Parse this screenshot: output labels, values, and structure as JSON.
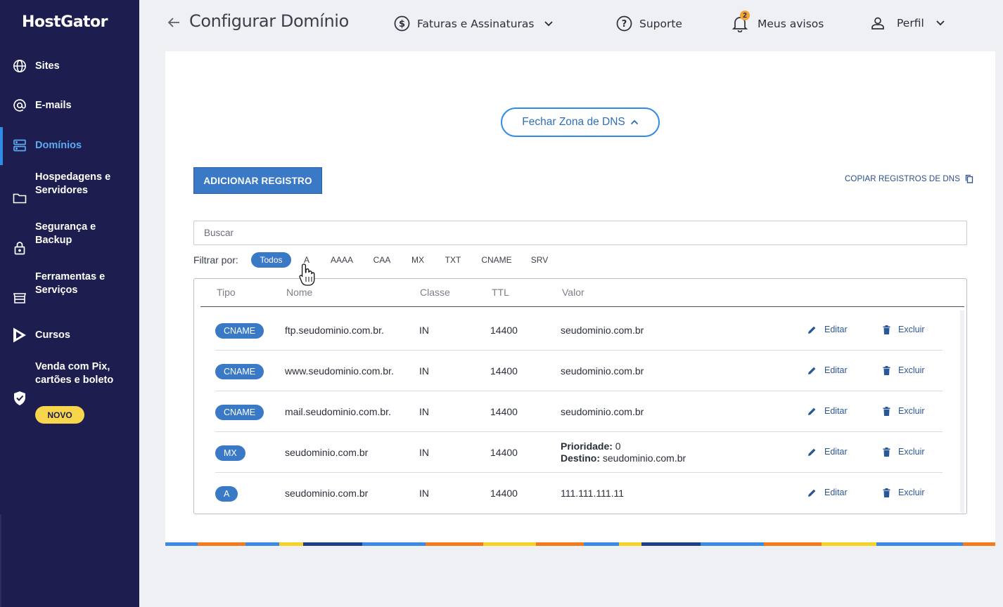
{
  "sidebar": {
    "logo": "HostGator",
    "items": [
      {
        "label": "Sites",
        "icon": "globe-icon"
      },
      {
        "label": "E-mails",
        "icon": "at-icon"
      },
      {
        "label": "Domínios",
        "icon": "server-icon",
        "active": true
      },
      {
        "label": "Hospedagens e Servidores",
        "icon": "folder-icon"
      },
      {
        "label": "Segurança e Backup",
        "icon": "lock-icon"
      },
      {
        "label": "Ferramentas e Serviços",
        "icon": "store-icon"
      },
      {
        "label": "Cursos",
        "icon": "play-icon"
      },
      {
        "label": "Venda com Pix, cartões e boleto",
        "icon": "shield-check-icon"
      }
    ],
    "badge_novo": "NOVO"
  },
  "header": {
    "title": "Configurar Domínio",
    "links": {
      "billing": "Faturas e Assinaturas",
      "support": "Suporte",
      "notices": "Meus avisos",
      "notices_count": "2",
      "profile": "Perfil"
    }
  },
  "dns": {
    "close_zone_button": "Fechar Zona de DNS",
    "add_record_button": "ADICIONAR REGISTRO",
    "copy_records_link": "COPIAR REGISTROS DE DNS",
    "search_placeholder": "Buscar",
    "filter_label": "Filtrar por:",
    "filters": [
      "Todos",
      "A",
      "AAAA",
      "CAA",
      "MX",
      "TXT",
      "CNAME",
      "SRV"
    ],
    "active_filter": "Todos",
    "columns": {
      "tipo": "Tipo",
      "nome": "Nome",
      "classe": "Classe",
      "ttl": "TTL",
      "valor": "Valor"
    },
    "edit_label": "Editar",
    "delete_label": "Excluir",
    "records": [
      {
        "tipo": "CNAME",
        "nome": "ftp.seudominio.com.br.",
        "classe": "IN",
        "ttl": "14400",
        "valor": "seudominio.com.br"
      },
      {
        "tipo": "CNAME",
        "nome": "www.seudominio.com.br.",
        "classe": "IN",
        "ttl": "14400",
        "valor": "seudominio.com.br"
      },
      {
        "tipo": "CNAME",
        "nome": "mail.seudominio.com.br.",
        "classe": "IN",
        "ttl": "14400",
        "valor": "seudominio.com.br"
      },
      {
        "tipo": "MX",
        "nome": "seudominio.com.br",
        "classe": "IN",
        "ttl": "14400",
        "prioridade_label": "Prioridade:",
        "prioridade": "0",
        "destino_label": "Destino:",
        "destino": "seudominio.com.br"
      },
      {
        "tipo": "A",
        "nome": "seudominio.com.br",
        "classe": "IN",
        "ttl": "14400",
        "valor": "111.111.111.11"
      }
    ]
  },
  "colors": {
    "sidebar_bg": "#1d1e4f",
    "accent": "#3979c6",
    "active_nav": "#5aaaf4",
    "badge_yellow": "#f7d64b"
  }
}
